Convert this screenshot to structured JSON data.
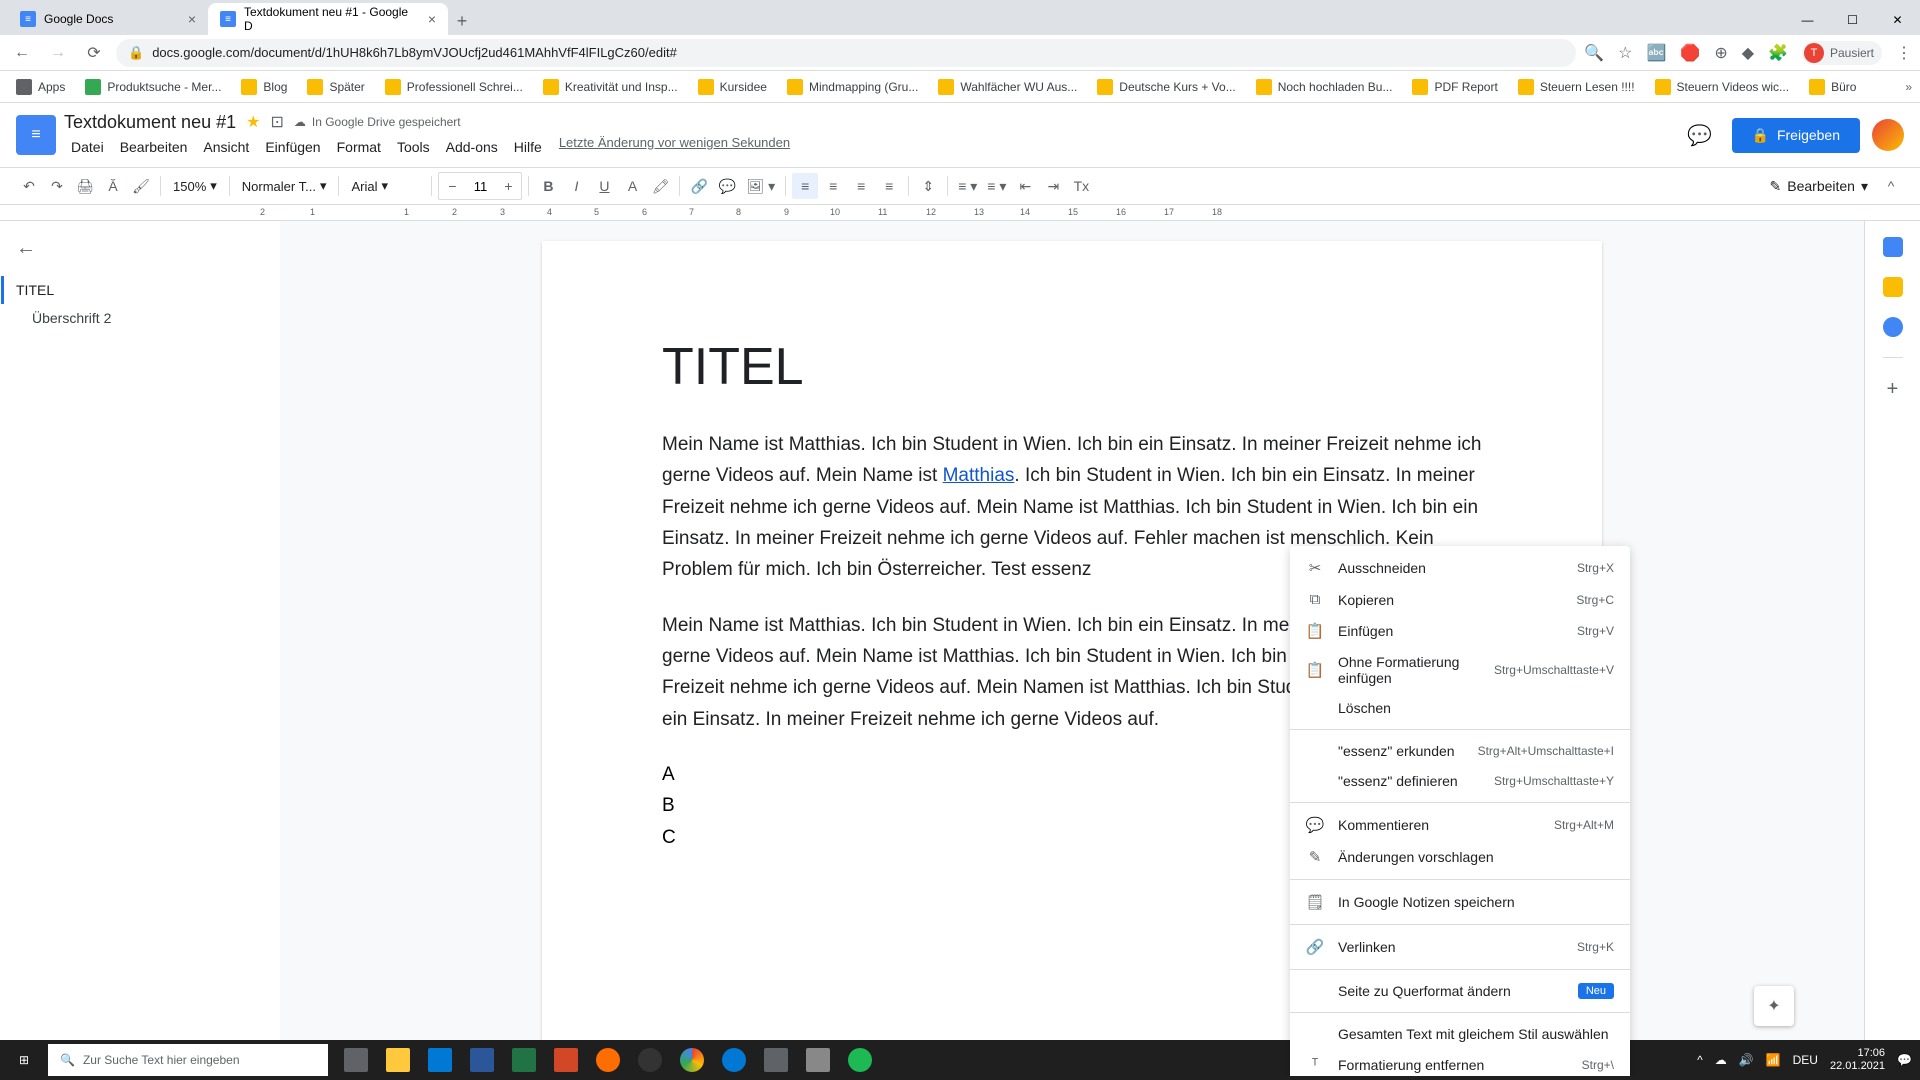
{
  "browser": {
    "tabs": [
      {
        "title": "Google Docs",
        "active": false
      },
      {
        "title": "Textdokument neu #1 - Google D",
        "active": true
      }
    ],
    "url": "docs.google.com/document/d/1hUH8k6h7Lb8ymVJOUcfj2ud461MAhhVfF4lFILgCz60/edit#",
    "profile_status": "Pausiert",
    "bookmarks": [
      "Apps",
      "Produktsuche - Mer...",
      "Blog",
      "Später",
      "Professionell Schrei...",
      "Kreativität und Insp...",
      "Kursidee",
      "Mindmapping (Gru...",
      "Wahlfächer WU Aus...",
      "Deutsche Kurs + Vo...",
      "Noch hochladen Bu...",
      "PDF Report",
      "Steuern Lesen !!!!",
      "Steuern Videos wic...",
      "Büro"
    ]
  },
  "docs": {
    "title": "Textdokument neu #1",
    "drive_status": "In Google Drive gespeichert",
    "menus": [
      "Datei",
      "Bearbeiten",
      "Ansicht",
      "Einfügen",
      "Format",
      "Tools",
      "Add-ons",
      "Hilfe"
    ],
    "last_edit": "Letzte Änderung vor wenigen Sekunden",
    "share_label": "Freigeben",
    "toolbar": {
      "zoom": "150%",
      "style": "Normaler T...",
      "font": "Arial",
      "font_size": "11",
      "edit_mode": "Bearbeiten"
    },
    "ruler_marks": [
      "2",
      "1",
      "1",
      "2",
      "3",
      "4",
      "5",
      "6",
      "7",
      "8",
      "9",
      "10",
      "11",
      "12",
      "13",
      "14",
      "15",
      "16",
      "17",
      "18"
    ]
  },
  "outline": {
    "h1": "TITEL",
    "h2": "Überschrift 2"
  },
  "document": {
    "heading": "TITEL",
    "p1_a": "Mein Name ist Matthias. Ich bin Student in Wien. Ich bin ein Einsatz. In meiner Freizeit nehme ich gerne Videos auf. Mein Name ist ",
    "p1_link": "Matthias",
    "p1_b": ". Ich bin Student in Wien. Ich bin ein Einsatz. In meiner Freizeit nehme ich gerne Videos auf. Mein Name ist Matthias. Ich bin Student in Wien. Ich bin ein Einsatz. In meiner Freizeit nehme ich gerne Videos auf. Fehler machen ist menschlich. Kein Problem für mich. Ich bin Österreicher. Test essenz",
    "p2": "Mein Name ist Matthias. Ich bin Student in Wien. Ich bin ein Einsatz. In meiner Freizeit nehme ich gerne Videos auf. Mein Name ist Matthias. Ich bin Student in Wien. Ich bin ein Einsatz. In meiner Freizeit nehme ich gerne Videos auf. Mein Namen ist Matthias. Ich bin Student in Wien. Ich bin ein Einsatz. In meiner Freizeit nehme ich gerne Videos auf.",
    "list": [
      "A",
      "B",
      "C"
    ]
  },
  "context_menu": {
    "items": [
      {
        "icon": "✂",
        "label": "Ausschneiden",
        "shortcut": "Strg+X"
      },
      {
        "icon": "⧉",
        "label": "Kopieren",
        "shortcut": "Strg+C"
      },
      {
        "icon": "📋",
        "label": "Einfügen",
        "shortcut": "Strg+V"
      },
      {
        "icon": "📋",
        "label": "Ohne Formatierung einfügen",
        "shortcut": "Strg+Umschalttaste+V"
      },
      {
        "icon": "",
        "label": "Löschen",
        "shortcut": ""
      },
      {
        "sep": true
      },
      {
        "icon": "",
        "label": "\"essenz\" erkunden",
        "shortcut": "Strg+Alt+Umschalttaste+I"
      },
      {
        "icon": "",
        "label": "\"essenz\" definieren",
        "shortcut": "Strg+Umschalttaste+Y"
      },
      {
        "sep": true
      },
      {
        "icon": "💬",
        "label": "Kommentieren",
        "shortcut": "Strg+Alt+M"
      },
      {
        "icon": "✎",
        "label": "Änderungen vorschlagen",
        "shortcut": ""
      },
      {
        "sep": true
      },
      {
        "icon": "🗒",
        "label": "In Google Notizen speichern",
        "shortcut": ""
      },
      {
        "sep": true
      },
      {
        "icon": "🔗",
        "label": "Verlinken",
        "shortcut": "Strg+K"
      },
      {
        "sep": true
      },
      {
        "icon": "",
        "label": "Seite zu Querformat ändern",
        "badge": "Neu"
      },
      {
        "sep": true
      },
      {
        "icon": "",
        "label": "Gesamten Text mit gleichem Stil auswählen",
        "shortcut": ""
      },
      {
        "icon": "ᵀ",
        "label": "Formatierung entfernen",
        "shortcut": "Strg+\\"
      }
    ]
  },
  "taskbar": {
    "search_placeholder": "Zur Suche Text hier eingeben",
    "lang": "DEU",
    "time": "17:06",
    "date": "22.01.2021"
  }
}
